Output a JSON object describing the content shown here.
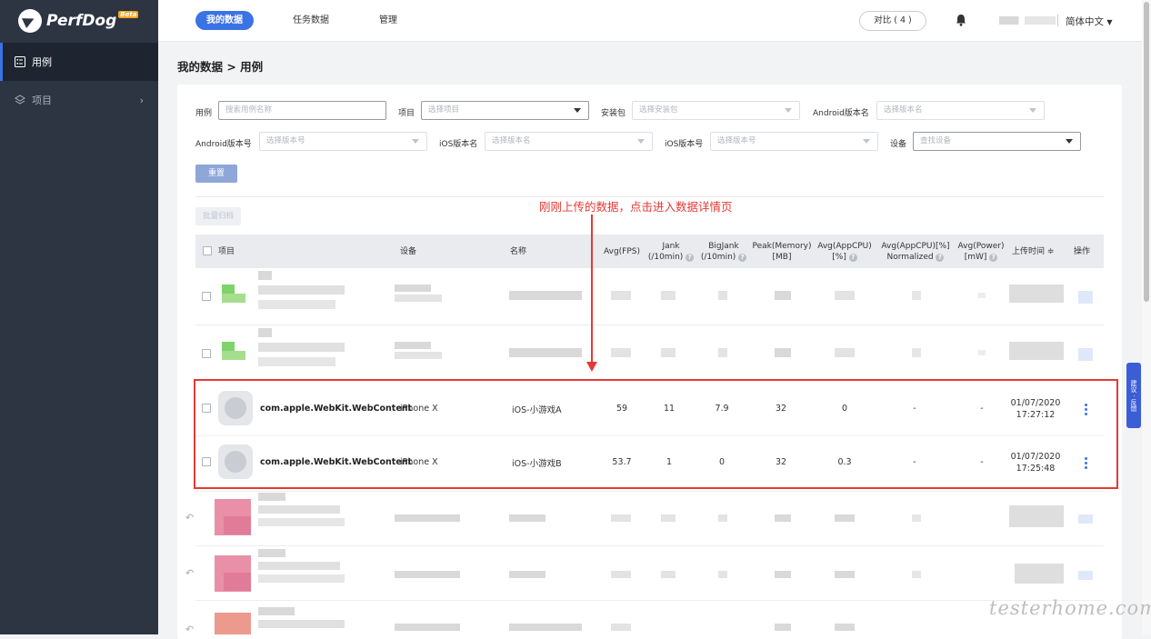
{
  "app": {
    "brand": "PerfDog",
    "badge": "Beta"
  },
  "sidebar": {
    "items": [
      {
        "label": "用例",
        "icon": "list-icon"
      },
      {
        "label": "项目",
        "icon": "layers-icon"
      }
    ]
  },
  "topbar": {
    "tabs": [
      {
        "label": "我的数据"
      },
      {
        "label": "任务数据"
      },
      {
        "label": "管理"
      }
    ],
    "compare_label": "对比 ( 4 )",
    "language": "简体中文"
  },
  "breadcrumb": "我的数据 > 用例",
  "filters": {
    "case_label": "用例",
    "case_placeholder": "搜索用例名称",
    "project_label": "项目",
    "project_placeholder": "选择项目",
    "package_label": "安装包",
    "package_placeholder": "选择安装包",
    "android_version_name_label": "Android版本名",
    "android_version_name_placeholder": "选择版本名",
    "android_version_code_label": "Android版本号",
    "android_version_code_placeholder": "选择版本号",
    "ios_version_name_label": "iOS版本名",
    "ios_version_name_placeholder": "选择版本名",
    "ios_version_code_label": "iOS版本号",
    "ios_version_code_placeholder": "选择版本号",
    "device_label": "设备",
    "device_placeholder": "查找设备"
  },
  "buttons": {
    "reset": "重置",
    "batch_archive": "批量归档"
  },
  "annotation": "刚刚上传的数据，点击进入数据详情页",
  "table": {
    "columns": [
      {
        "key": "project",
        "label": "项目"
      },
      {
        "key": "device",
        "label": "设备"
      },
      {
        "key": "name",
        "label": "名称"
      },
      {
        "key": "fps",
        "label": "Avg(FPS)"
      },
      {
        "key": "jank",
        "label": "Jank",
        "sub": "(/10min)"
      },
      {
        "key": "bigjank",
        "label": "BigJank",
        "sub": "(/10min)"
      },
      {
        "key": "memory",
        "label": "Peak(Memory)",
        "sub": "[MB]"
      },
      {
        "key": "cpu",
        "label": "Avg(AppCPU)",
        "sub": "[%]"
      },
      {
        "key": "cpu_norm",
        "label": "Avg(AppCPU)[%]",
        "sub": "Normalized"
      },
      {
        "key": "power",
        "label": "Avg(Power)",
        "sub": "[mW]"
      },
      {
        "key": "upload",
        "label": "上传时间 ≑"
      },
      {
        "key": "ops",
        "label": "操作"
      }
    ],
    "rows": [
      {
        "project": "com.apple.WebKit.WebContent",
        "device": "iPhone X",
        "name": "iOS-小游戏A",
        "fps": "59",
        "jank": "11",
        "bigjank": "7.9",
        "memory": "32",
        "cpu": "0",
        "cpu_norm": "-",
        "power": "-",
        "date": "01/07/2020",
        "time": "17:27:12"
      },
      {
        "project": "com.apple.WebKit.WebContent",
        "device": "iPhone X",
        "name": "iOS-小游戏B",
        "fps": "53.7",
        "jank": "1",
        "bigjank": "0",
        "memory": "32",
        "cpu": "0.3",
        "cpu_norm": "-",
        "power": "-",
        "date": "01/07/2020",
        "time": "17:25:48"
      }
    ]
  },
  "feedback": "建议 · 反馈",
  "watermark": "testerhome.com",
  "colors": {
    "sidebar": "#2d3543",
    "accent": "#3b73e6",
    "highlight": "#e53935"
  }
}
